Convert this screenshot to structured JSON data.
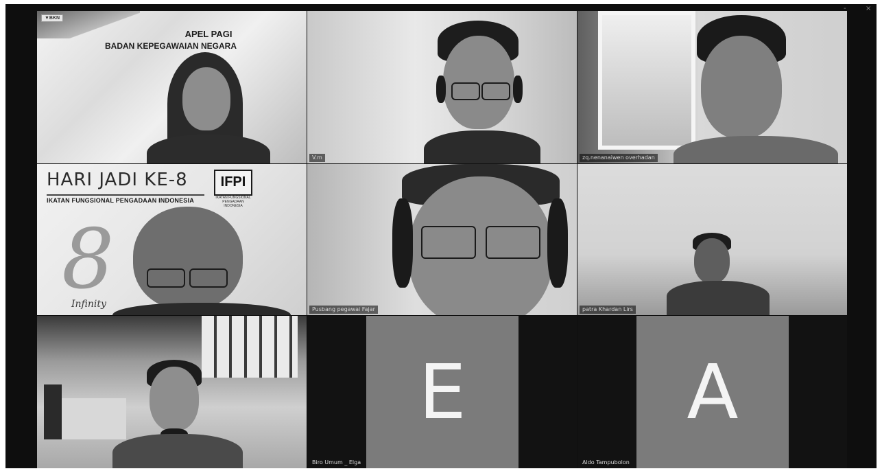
{
  "window": {
    "controls": [
      "-",
      "×"
    ]
  },
  "tiles": [
    {
      "id": "apel",
      "name": "",
      "badge": "▼BKN",
      "banner_title": "APEL PAGI",
      "banner_subtitle": "BADAN KEPEGAWAIAN NEGARA"
    },
    {
      "id": "p2",
      "name": "V.m"
    },
    {
      "id": "p3",
      "name": "zq.nenanaiwen overhadan"
    },
    {
      "id": "hari",
      "name": "",
      "banner_title": "HARI JADI KE-8",
      "banner_subtitle": "IKATAN FUNGSIONAL PENGADAAN INDONESIA",
      "logo_text": "IFPI",
      "logo_caption": "IKATAN FUNGSIONAL PENGADAAN INDONESIA",
      "script_text": "Infinity"
    },
    {
      "id": "p5",
      "name": "Pusbang pegawai Fajar"
    },
    {
      "id": "p6",
      "name": "patra Khardan Lirs"
    },
    {
      "id": "p7",
      "name": ""
    },
    {
      "id": "p8",
      "name": "Biro Umum _ Elga",
      "initial": "E"
    },
    {
      "id": "p9",
      "name": "Aldo Tampubolon",
      "initial": "A"
    }
  ]
}
